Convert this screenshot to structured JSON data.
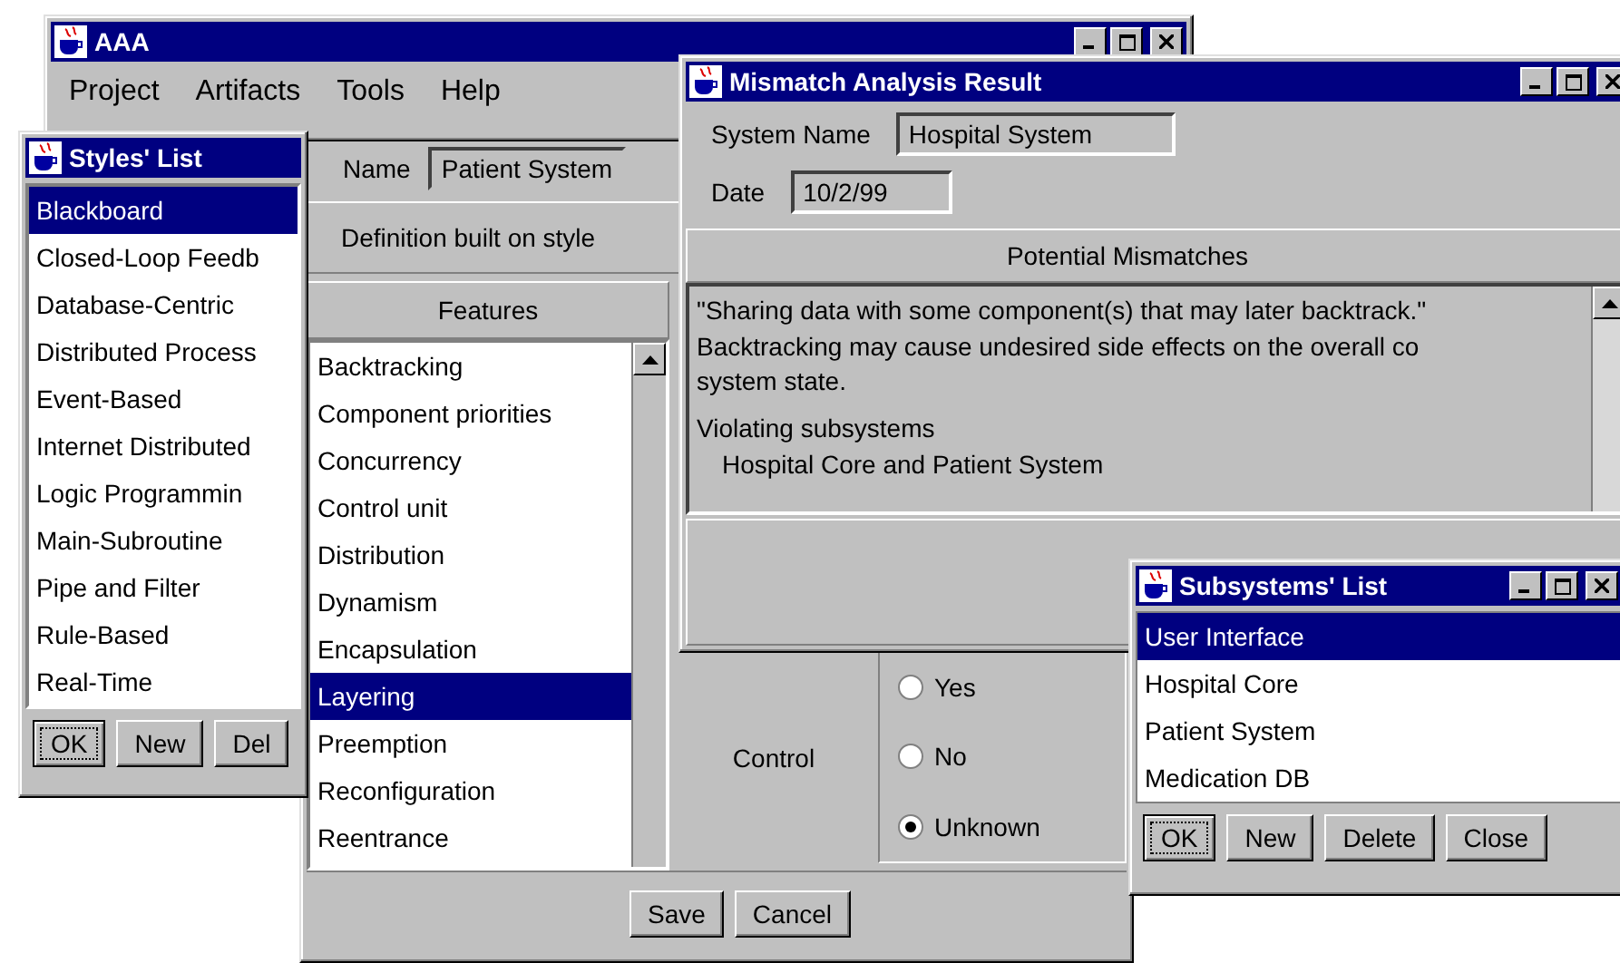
{
  "main_window": {
    "title": "AAA",
    "menu": [
      "Project",
      "Artifacts",
      "Tools",
      "Help"
    ]
  },
  "styles_window": {
    "title": "Styles' List",
    "items": [
      {
        "label": "Blackboard",
        "selected": true
      },
      {
        "label": "Closed-Loop Feedb",
        "selected": false
      },
      {
        "label": "Database-Centric",
        "selected": false
      },
      {
        "label": "Distributed Process",
        "selected": false
      },
      {
        "label": "Event-Based",
        "selected": false
      },
      {
        "label": "Internet Distributed",
        "selected": false
      },
      {
        "label": "Logic Programmin",
        "selected": false
      },
      {
        "label": "Main-Subroutine",
        "selected": false
      },
      {
        "label": "Pipe and Filter",
        "selected": false
      },
      {
        "label": "Rule-Based",
        "selected": false
      },
      {
        "label": "Real-Time",
        "selected": false
      }
    ],
    "buttons": [
      {
        "label": "OK",
        "focused": true
      },
      {
        "label": "New",
        "focused": false
      },
      {
        "label": "Del",
        "focused": false
      }
    ]
  },
  "editor": {
    "name_label": "Name",
    "name_value": "Patient System",
    "definition_label": "Definition built on style",
    "features_heading": "Features",
    "features": [
      {
        "label": "Backtracking",
        "selected": false
      },
      {
        "label": "Component priorities",
        "selected": false
      },
      {
        "label": "Concurrency",
        "selected": false
      },
      {
        "label": "Control unit",
        "selected": false
      },
      {
        "label": "Distribution",
        "selected": false
      },
      {
        "label": "Dynamism",
        "selected": false
      },
      {
        "label": "Encapsulation",
        "selected": false
      },
      {
        "label": "Layering",
        "selected": true
      },
      {
        "label": "Preemption",
        "selected": false
      },
      {
        "label": "Reconfiguration",
        "selected": false
      },
      {
        "label": "Reentrance",
        "selected": false
      }
    ],
    "control": {
      "label": "Control",
      "options": [
        {
          "label": "Yes",
          "selected": false
        },
        {
          "label": "No",
          "selected": false
        },
        {
          "label": "Unknown",
          "selected": true
        }
      ]
    },
    "buttons": [
      "Save",
      "Cancel"
    ]
  },
  "mismatch_window": {
    "title": "Mismatch Analysis Result",
    "system_name_label": "System Name",
    "system_name_value": "Hospital System",
    "date_label": "Date",
    "date_value": "10/2/99",
    "heading": "Potential Mismatches",
    "lines": [
      {
        "kind": "line",
        "text": "\"Sharing data with some component(s) that may later backtrack.\""
      },
      {
        "kind": "line",
        "text": "Backtracking may cause undesired side effects on the overall co"
      },
      {
        "kind": "cont",
        "text": "system state."
      },
      {
        "kind": "line",
        "text": "Violating subsystems"
      },
      {
        "kind": "indent",
        "text": "Hospital Core and Patient System"
      }
    ]
  },
  "subsystems_window": {
    "title": "Subsystems' List",
    "items": [
      {
        "label": "User Interface",
        "selected": true
      },
      {
        "label": "Hospital Core",
        "selected": false
      },
      {
        "label": "Patient System",
        "selected": false
      },
      {
        "label": "Medication DB",
        "selected": false
      }
    ],
    "buttons": [
      {
        "label": "OK",
        "focused": true
      },
      {
        "label": "New",
        "focused": false
      },
      {
        "label": "Delete",
        "focused": false
      },
      {
        "label": "Close",
        "focused": false
      }
    ]
  }
}
